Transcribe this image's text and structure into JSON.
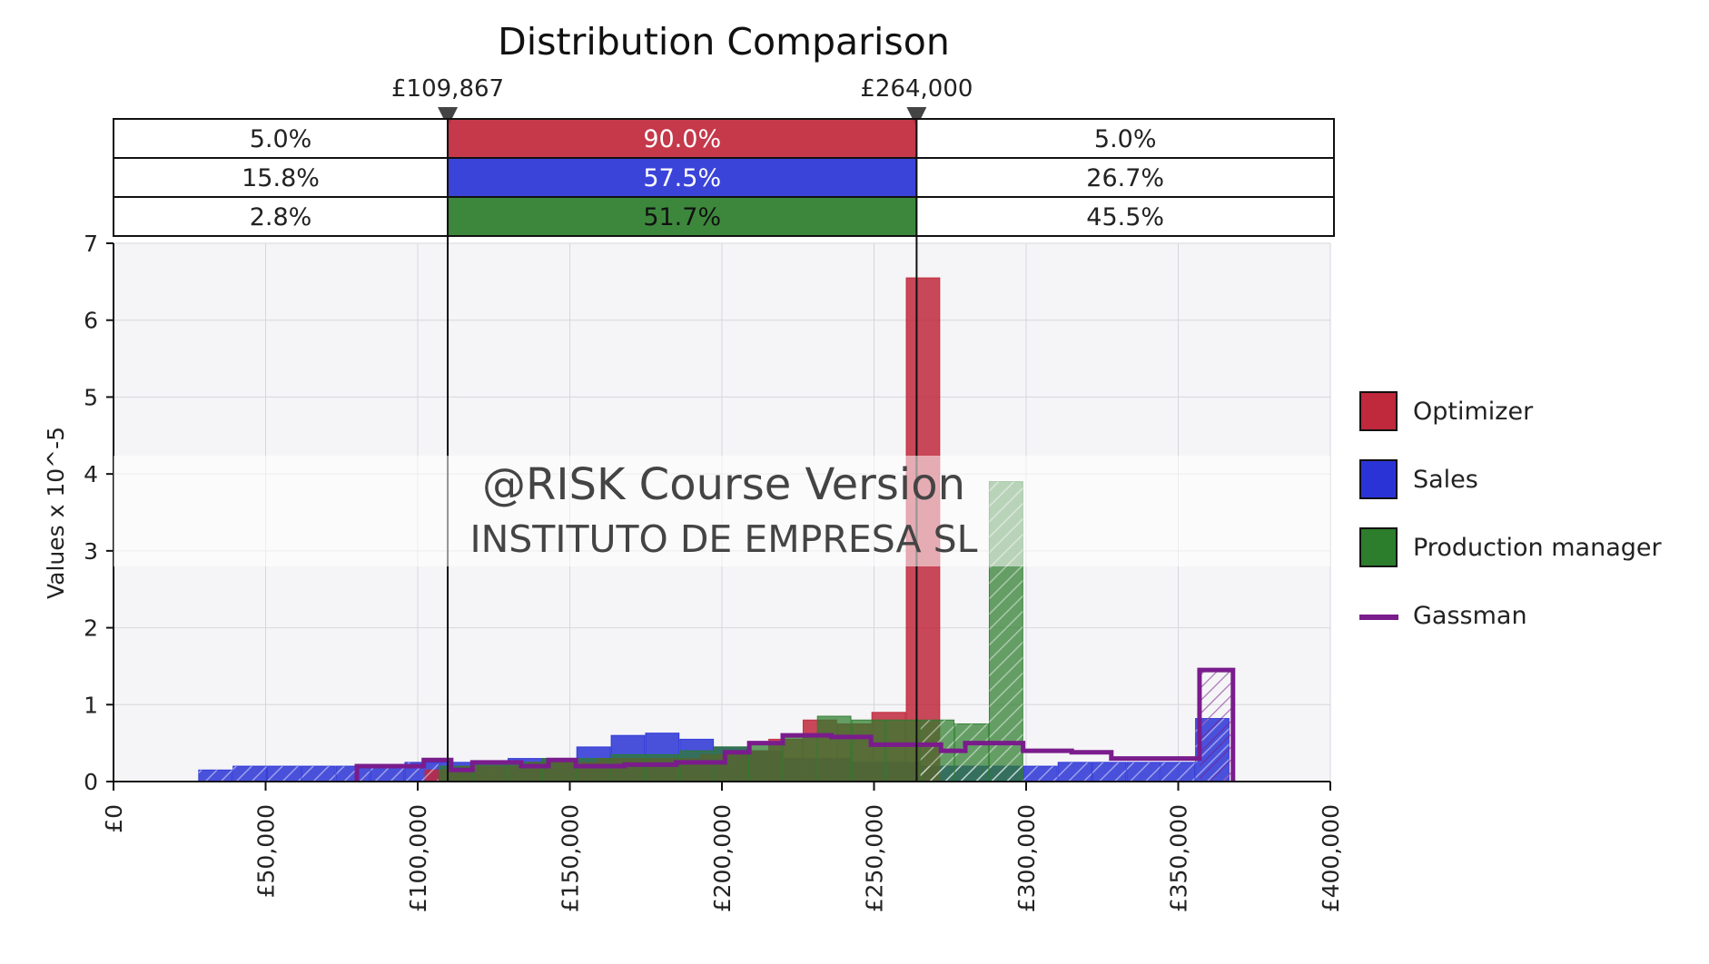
{
  "chart_data": {
    "type": "bar",
    "title": "Distribution Comparison",
    "xlabel": "",
    "ylabel": "Values x 10^-5",
    "xlim": [
      0,
      400000
    ],
    "ylim": [
      0,
      7
    ],
    "x_ticks": [
      "£0",
      "£50,000",
      "£100,000",
      "£150,000",
      "£200,000",
      "£250,000",
      "£300,000",
      "£350,000",
      "£400,000"
    ],
    "y_ticks": [
      "0",
      "1",
      "2",
      "3",
      "4",
      "5",
      "6",
      "7"
    ],
    "grid": true,
    "legend_position": "right",
    "markers": [
      {
        "value": 109867,
        "label": "£109,867"
      },
      {
        "value": 264000,
        "label": "£264,000"
      }
    ],
    "bands": [
      {
        "left": "5.0%",
        "middle": "90.0%",
        "right": "5.0%"
      },
      {
        "left": "15.8%",
        "middle": "57.5%",
        "right": "26.7%"
      },
      {
        "left": "2.8%",
        "middle": "51.7%",
        "right": "45.5%"
      }
    ],
    "bin_width": 11300,
    "series": [
      {
        "name": "Optimizer",
        "style": "bars",
        "color": "#c0283c",
        "bins": [
          {
            "x": 102400,
            "y": 0.15
          },
          {
            "x": 113700,
            "y": 0.2
          },
          {
            "x": 125000,
            "y": 0.2
          },
          {
            "x": 136300,
            "y": 0.25
          },
          {
            "x": 147600,
            "y": 0.25
          },
          {
            "x": 158900,
            "y": 0.3
          },
          {
            "x": 170200,
            "y": 0.3
          },
          {
            "x": 181500,
            "y": 0.3
          },
          {
            "x": 192800,
            "y": 0.35
          },
          {
            "x": 204100,
            "y": 0.4
          },
          {
            "x": 215400,
            "y": 0.55
          },
          {
            "x": 226700,
            "y": 0.8
          },
          {
            "x": 238000,
            "y": 0.75
          },
          {
            "x": 249300,
            "y": 0.9
          },
          {
            "x": 260600,
            "y": 6.55
          }
        ]
      },
      {
        "name": "Sales",
        "style": "bars",
        "color": "#2a34d6",
        "bins": [
          {
            "x": 28000,
            "y": 0.15
          },
          {
            "x": 39300,
            "y": 0.2
          },
          {
            "x": 50600,
            "y": 0.2
          },
          {
            "x": 61900,
            "y": 0.2
          },
          {
            "x": 73200,
            "y": 0.2
          },
          {
            "x": 84500,
            "y": 0.22
          },
          {
            "x": 95800,
            "y": 0.25
          },
          {
            "x": 107100,
            "y": 0.25
          },
          {
            "x": 118400,
            "y": 0.25
          },
          {
            "x": 129700,
            "y": 0.3
          },
          {
            "x": 141000,
            "y": 0.3
          },
          {
            "x": 152300,
            "y": 0.45
          },
          {
            "x": 163600,
            "y": 0.6
          },
          {
            "x": 174900,
            "y": 0.63
          },
          {
            "x": 186200,
            "y": 0.55
          },
          {
            "x": 197500,
            "y": 0.45
          },
          {
            "x": 208800,
            "y": 0.4
          },
          {
            "x": 220100,
            "y": 0.3
          },
          {
            "x": 231400,
            "y": 0.3
          },
          {
            "x": 242700,
            "y": 0.25
          },
          {
            "x": 254000,
            "y": 0.25
          },
          {
            "x": 265300,
            "y": 0.2
          },
          {
            "x": 276600,
            "y": 0.2
          },
          {
            "x": 287900,
            "y": 0.2
          },
          {
            "x": 299200,
            "y": 0.2
          },
          {
            "x": 310500,
            "y": 0.25
          },
          {
            "x": 321800,
            "y": 0.25
          },
          {
            "x": 333100,
            "y": 0.25
          },
          {
            "x": 344400,
            "y": 0.25
          },
          {
            "x": 355700,
            "y": 0.82
          }
        ]
      },
      {
        "name": "Production manager",
        "style": "bars",
        "color": "#2c7d2c",
        "bins": [
          {
            "x": 107100,
            "y": 0.2
          },
          {
            "x": 118400,
            "y": 0.25
          },
          {
            "x": 129700,
            "y": 0.25
          },
          {
            "x": 141000,
            "y": 0.3
          },
          {
            "x": 152300,
            "y": 0.3
          },
          {
            "x": 163600,
            "y": 0.35
          },
          {
            "x": 174900,
            "y": 0.35
          },
          {
            "x": 186200,
            "y": 0.4
          },
          {
            "x": 197500,
            "y": 0.45
          },
          {
            "x": 208800,
            "y": 0.5
          },
          {
            "x": 220100,
            "y": 0.6
          },
          {
            "x": 231400,
            "y": 0.85
          },
          {
            "x": 242700,
            "y": 0.8
          },
          {
            "x": 254000,
            "y": 0.8
          },
          {
            "x": 265300,
            "y": 0.8
          },
          {
            "x": 276600,
            "y": 0.75
          },
          {
            "x": 287900,
            "y": 3.9
          }
        ]
      },
      {
        "name": "Gassman",
        "style": "step",
        "color": "#7a1c8c",
        "steps": [
          {
            "x": 80000,
            "y": 0.2
          },
          {
            "x": 102000,
            "y": 0.28
          },
          {
            "x": 111000,
            "y": 0.15
          },
          {
            "x": 118000,
            "y": 0.25
          },
          {
            "x": 126000,
            "y": 0.25
          },
          {
            "x": 134000,
            "y": 0.2
          },
          {
            "x": 143000,
            "y": 0.28
          },
          {
            "x": 152000,
            "y": 0.2
          },
          {
            "x": 168000,
            "y": 0.22
          },
          {
            "x": 185000,
            "y": 0.25
          },
          {
            "x": 201000,
            "y": 0.38
          },
          {
            "x": 209000,
            "y": 0.5
          },
          {
            "x": 220000,
            "y": 0.6
          },
          {
            "x": 236000,
            "y": 0.58
          },
          {
            "x": 249000,
            "y": 0.48
          },
          {
            "x": 272000,
            "y": 0.4
          },
          {
            "x": 280000,
            "y": 0.5
          },
          {
            "x": 299000,
            "y": 0.4
          },
          {
            "x": 315000,
            "y": 0.38
          },
          {
            "x": 328000,
            "y": 0.3
          },
          {
            "x": 357000,
            "y": 1.45
          },
          {
            "x": 368000,
            "y": 0
          }
        ]
      }
    ]
  },
  "watermark": {
    "line1": "@RISK Course Version",
    "line2": "INSTITUTO DE EMPRESA SL"
  }
}
